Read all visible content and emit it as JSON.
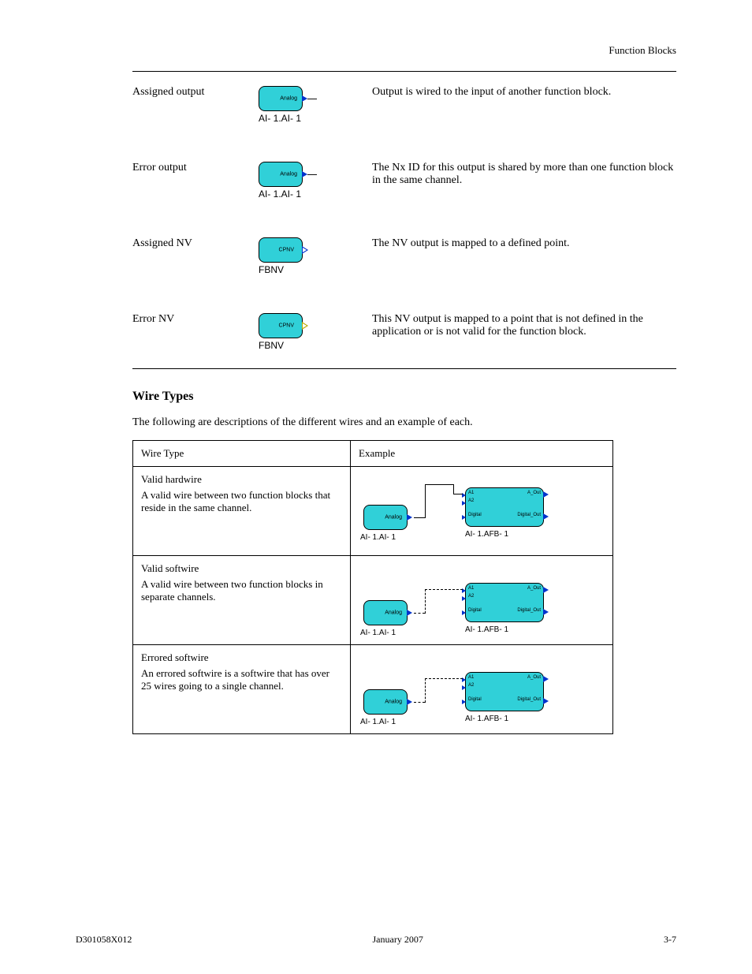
{
  "header": {
    "right": "Function Blocks"
  },
  "entries": [
    {
      "label": "Assigned output",
      "block_text": "Analog",
      "caption": "AI- 1.AI- 1",
      "desc": "Output is wired to the input of another function block."
    },
    {
      "label": "Error output",
      "block_text": "Analog",
      "caption": "AI- 1.AI- 1",
      "desc": "The Nx ID for this output is shared by more than one function block in the same channel."
    },
    {
      "label": "Assigned NV",
      "block_text": "CPNV",
      "caption": "FBNV",
      "desc": "The NV output is mapped to a defined point.",
      "outline_tri": true
    },
    {
      "label": "Error NV",
      "block_text": "CPNV",
      "caption": "FBNV",
      "desc": "This NV output is mapped to a point that is not defined in the application or is not valid for the function block.",
      "yellow_tri": true
    }
  ],
  "section": {
    "heading": "Wire Types",
    "para": "The following are descriptions of the different wires and an example of each.",
    "table": {
      "headers": [
        "Wire Type",
        "Example"
      ],
      "rows": [
        {
          "label": "Valid hardwire",
          "desc": "A valid wire between two function blocks that reside in the same channel.",
          "src_text": "Analog",
          "src_caption": "AI- 1.AI- 1",
          "dst_caption": "AI- 1.AFB- 1",
          "dst_ports_left": [
            "A1",
            "A2",
            "Digital"
          ],
          "dst_ports_right": [
            "A_Out",
            " ",
            "Digital_Out"
          ],
          "wire_style": "solid"
        },
        {
          "label": "Valid softwire",
          "desc": "A valid wire between two function blocks in separate channels.",
          "src_text": "Analog",
          "src_caption": "AI- 1.AI- 1",
          "dst_caption": "AI- 1.AFB- 1",
          "dst_ports_left": [
            "A1",
            "A2",
            "Digital"
          ],
          "dst_ports_right": [
            "A_Out",
            " ",
            "Digital_Out"
          ],
          "wire_style": "dash"
        },
        {
          "label": "Errored softwire",
          "desc": "An errored softwire is a softwire that has over 25 wires going to a single channel.",
          "src_text": "Analog",
          "src_caption": "AI- 1.AI- 1",
          "dst_caption": "AI- 1.AFB- 1",
          "dst_ports_left": [
            "A1",
            "A2",
            "Digital"
          ],
          "dst_ports_right": [
            "A_Out",
            " ",
            "Digital_Out"
          ],
          "wire_style": "dashdot"
        }
      ]
    }
  },
  "footer": {
    "doc_id": "D301058X012",
    "date": "January 2007",
    "page": "3-7"
  }
}
